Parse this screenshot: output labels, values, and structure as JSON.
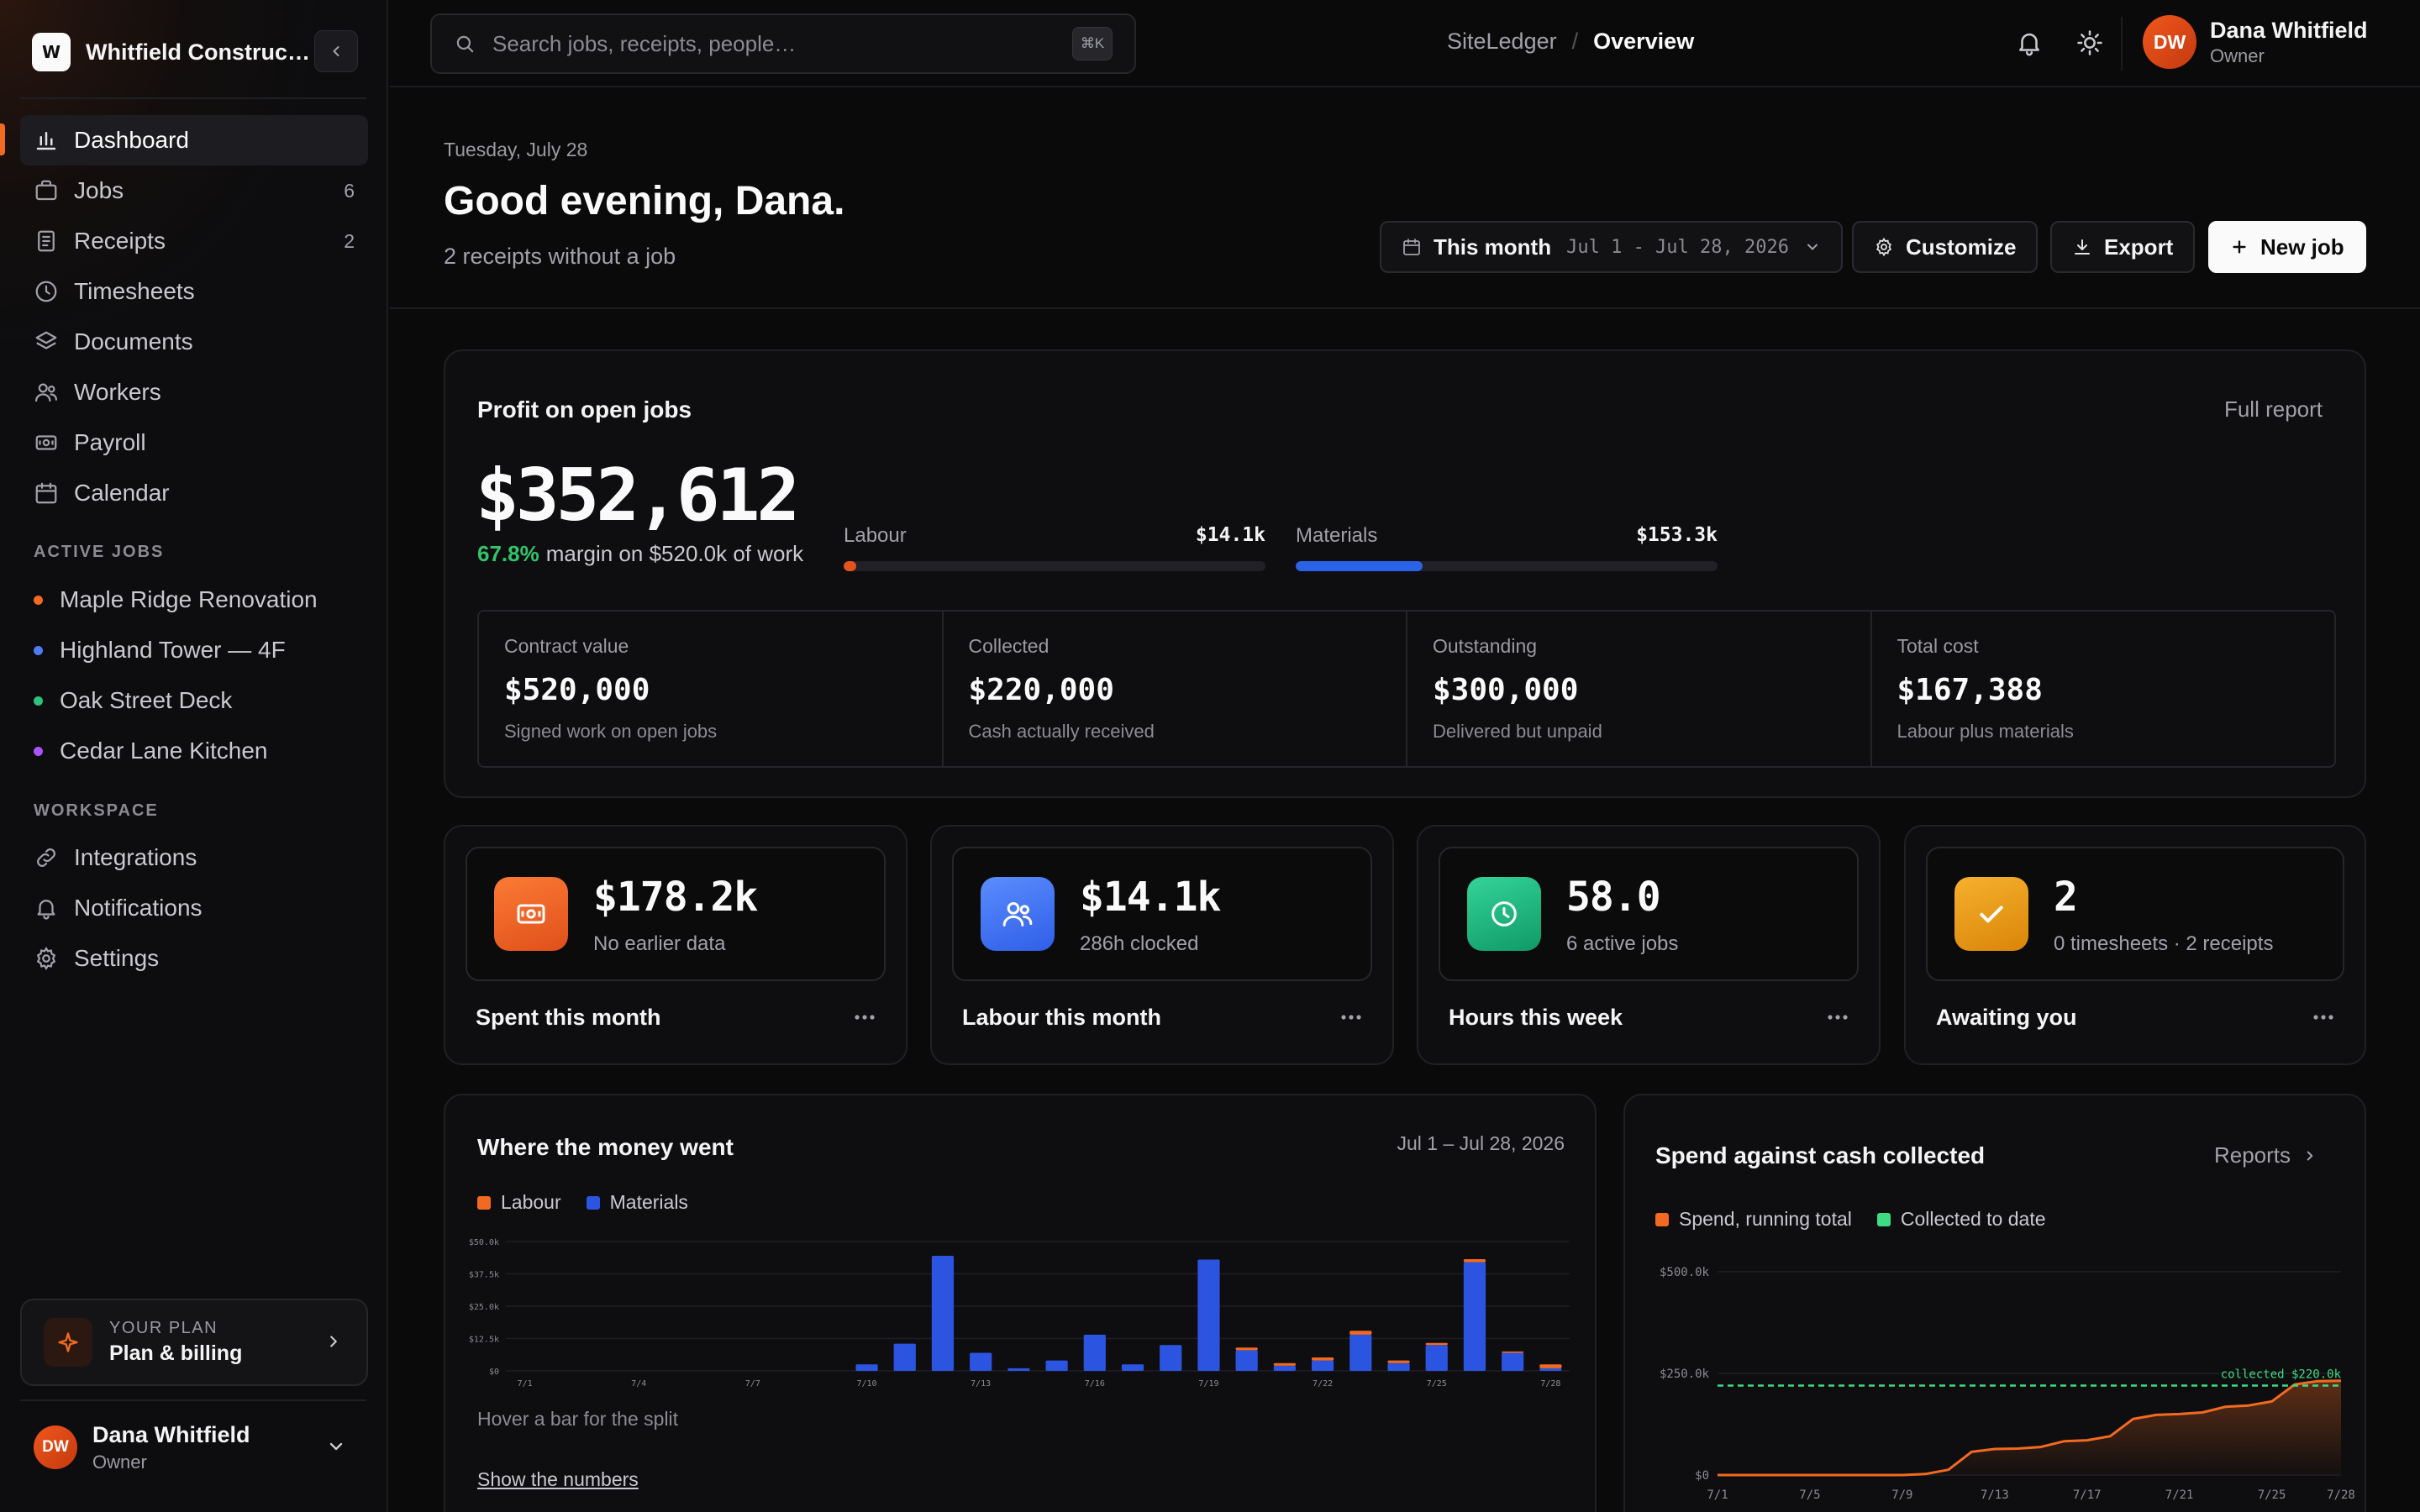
{
  "sidebar": {
    "brand_initial": "W",
    "brand_name": "Whitfield Construction",
    "nav": [
      {
        "label": "Dashboard",
        "icon": "bar-chart-icon",
        "count": ""
      },
      {
        "label": "Jobs",
        "icon": "briefcase-icon",
        "count": "6"
      },
      {
        "label": "Receipts",
        "icon": "receipt-icon",
        "count": "2"
      },
      {
        "label": "Timesheets",
        "icon": "clock-icon",
        "count": ""
      },
      {
        "label": "Documents",
        "icon": "layers-icon",
        "count": ""
      },
      {
        "label": "Workers",
        "icon": "users-icon",
        "count": ""
      },
      {
        "label": "Payroll",
        "icon": "banknote-icon",
        "count": ""
      },
      {
        "label": "Calendar",
        "icon": "calendar-icon",
        "count": ""
      }
    ],
    "active_jobs_label": "ACTIVE JOBS",
    "active_jobs": [
      {
        "label": "Maple Ridge Renovation",
        "color": "#f26a21"
      },
      {
        "label": "Highland Tower — 4F",
        "color": "#4f7cf5"
      },
      {
        "label": "Oak Street Deck",
        "color": "#2fc27a"
      },
      {
        "label": "Cedar Lane Kitchen",
        "color": "#a855f7"
      }
    ],
    "workspace_label": "WORKSPACE",
    "workspace": [
      {
        "label": "Integrations",
        "icon": "link-icon"
      },
      {
        "label": "Notifications",
        "icon": "bell-icon"
      },
      {
        "label": "Settings",
        "icon": "gear-icon"
      }
    ],
    "plan": {
      "kicker": "YOUR PLAN",
      "title": "Plan & billing"
    },
    "user": {
      "initials": "DW",
      "name": "Dana Whitfield",
      "role": "Owner"
    }
  },
  "topbar": {
    "search_placeholder": "Search jobs, receipts, people…",
    "shortcut": "⌘K",
    "crumb_app": "SiteLedger",
    "crumb_sep": "/",
    "crumb_page": "Overview",
    "user": {
      "initials": "DW",
      "name": "Dana Whitfield",
      "role": "Owner"
    }
  },
  "header": {
    "date": "Tuesday, July 28",
    "greeting": "Good evening, Dana.",
    "subtitle": "2 receipts without a job",
    "period_label": "This month",
    "period_range": "Jul 1 - Jul 28, 2026",
    "customize_label": "Customize",
    "export_label": "Export",
    "new_job_label": "New job"
  },
  "profit": {
    "title": "Profit on open jobs",
    "link": "Full report",
    "amount": "$352,612",
    "margin_pct": "67.8%",
    "margin_text": "margin on $520.0k of work",
    "labour": {
      "label": "Labour",
      "value": "$14.1k",
      "fraction": 0.03,
      "color": "#e5521c"
    },
    "materials": {
      "label": "Materials",
      "value": "$153.3k",
      "fraction": 0.3,
      "color": "#2b63e8"
    },
    "stats": [
      {
        "label": "Contract value",
        "value": "$520,000",
        "note": "Signed work on open jobs"
      },
      {
        "label": "Collected",
        "value": "$220,000",
        "note": "Cash actually received"
      },
      {
        "label": "Outstanding",
        "value": "$300,000",
        "note": "Delivered but unpaid"
      },
      {
        "label": "Total cost",
        "value": "$167,388",
        "note": "Labour plus materials"
      }
    ]
  },
  "kpis": [
    {
      "value": "$178.2k",
      "sub": "No earlier data",
      "title": "Spent this month",
      "icon": "banknote-icon",
      "color_from": "#fb7a35",
      "color_to": "#e0501a"
    },
    {
      "value": "$14.1k",
      "sub": "286h clocked",
      "title": "Labour this month",
      "icon": "users-icon",
      "color_from": "#5b8cff",
      "color_to": "#2f5fe6"
    },
    {
      "value": "58.0",
      "sub": "6 active jobs",
      "title": "Hours this week",
      "icon": "clock-icon",
      "color_from": "#34d39a",
      "color_to": "#0f9a68"
    },
    {
      "value": "2",
      "sub": "0 timesheets · 2 receipts",
      "title": "Awaiting you",
      "icon": "check-icon",
      "color_from": "#f7b02e",
      "color_to": "#d98508"
    }
  ],
  "money_card": {
    "title": "Where the money went",
    "range": "Jul 1 – Jul 28, 2026",
    "hint": "Hover a bar for the split",
    "link": "Show the numbers"
  },
  "spend_card": {
    "title": "Spend against cash collected",
    "link": "Reports"
  },
  "chart_data": [
    {
      "type": "bar",
      "stacked": true,
      "categories": [
        "7/1",
        "7/2",
        "7/3",
        "7/4",
        "7/5",
        "7/6",
        "7/7",
        "7/8",
        "7/9",
        "7/10",
        "7/11",
        "7/12",
        "7/13",
        "7/14",
        "7/15",
        "7/16",
        "7/17",
        "7/18",
        "7/19",
        "7/20",
        "7/21",
        "7/22",
        "7/23",
        "7/24",
        "7/25",
        "7/26",
        "7/27",
        "7/28"
      ],
      "tick_labels": [
        "7/1",
        "7/4",
        "7/7",
        "7/10",
        "7/13",
        "7/16",
        "7/19",
        "7/22",
        "7/25",
        "7/28"
      ],
      "series": [
        {
          "name": "Labour",
          "color": "#f26a21",
          "values": [
            0,
            0,
            0,
            0,
            0,
            0,
            0,
            0,
            0,
            0,
            0,
            0,
            0,
            0,
            0,
            0,
            0,
            0,
            0,
            1.0,
            1.0,
            1.2,
            1.5,
            1.0,
            0.8,
            1.2,
            0.5,
            1.5
          ]
        },
        {
          "name": "Materials",
          "color": "#2b55e0",
          "values": [
            0,
            0,
            0,
            0,
            0,
            0,
            0,
            0,
            0,
            2.5,
            10.5,
            44.5,
            7.0,
            1.0,
            4.0,
            14.0,
            2.5,
            10.0,
            43.0,
            8.0,
            2.0,
            4.0,
            14.0,
            3.0,
            10.0,
            42.0,
            7.0,
            1.0
          ]
        }
      ],
      "yticks": [
        "$0",
        "$12.5k",
        "$25.0k",
        "$37.5k",
        "$50.0k"
      ],
      "ylim": [
        0,
        50
      ],
      "legend": "top-left"
    },
    {
      "type": "area",
      "x": [
        "7/1",
        "7/2",
        "7/3",
        "7/4",
        "7/5",
        "7/6",
        "7/7",
        "7/8",
        "7/9",
        "7/10",
        "7/11",
        "7/12",
        "7/13",
        "7/14",
        "7/15",
        "7/16",
        "7/17",
        "7/18",
        "7/19",
        "7/20",
        "7/21",
        "7/22",
        "7/23",
        "7/24",
        "7/25",
        "7/26",
        "7/27",
        "7/28"
      ],
      "tick_labels": [
        "7/1",
        "7/5",
        "7/9",
        "7/13",
        "7/17",
        "7/21",
        "7/25",
        "7/28"
      ],
      "series": [
        {
          "name": "Spend, running total",
          "color": "#f26a21",
          "values": [
            0,
            0,
            0,
            0,
            0,
            0,
            0,
            0,
            0,
            2.5,
            13,
            57,
            64,
            65,
            69,
            83,
            85.5,
            95.5,
            138,
            148,
            150,
            154,
            168,
            171,
            181,
            223,
            231,
            232
          ]
        },
        {
          "name": "Collected to date",
          "color": "#3ddc84",
          "values": [
            220,
            220,
            220,
            220,
            220,
            220,
            220,
            220,
            220,
            220,
            220,
            220,
            220,
            220,
            220,
            220,
            220,
            220,
            220,
            220,
            220,
            220,
            220,
            220,
            220,
            220,
            220,
            220
          ],
          "dashed": true
        }
      ],
      "annotation": "collected $220.0k",
      "yticks": [
        "$0",
        "$250.0k",
        "$500.0k"
      ],
      "ylim": [
        0,
        500
      ],
      "legend": "top-left"
    }
  ]
}
